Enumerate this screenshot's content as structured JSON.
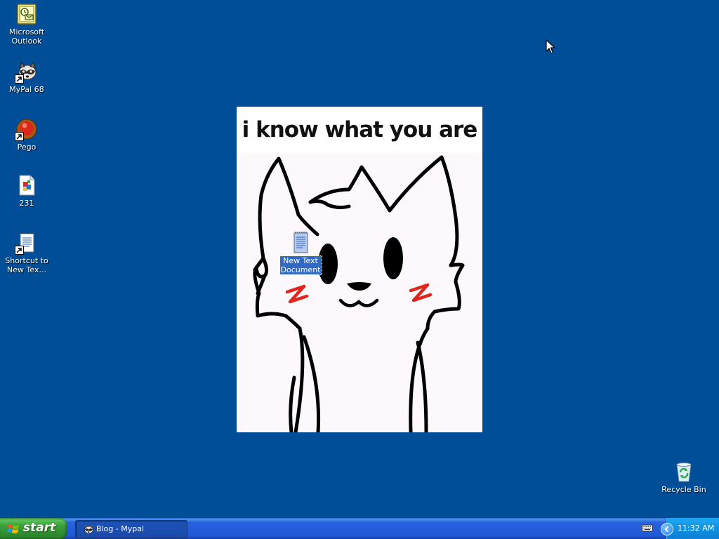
{
  "desktop": {
    "background_color": "#004e98",
    "icons": [
      {
        "label": "Microsoft\nOutlook",
        "icon": "outlook-icon"
      },
      {
        "label": "MyPal 68",
        "icon": "raccoon-browser-icon"
      },
      {
        "label": "Pego",
        "icon": "pego-icon"
      },
      {
        "label": "231",
        "icon": "image-file-icon"
      },
      {
        "label": "Shortcut to\nNew Tex...",
        "icon": "notepad-shortcut-icon"
      },
      {
        "label": "New Text\nDocument",
        "icon": "text-document-icon"
      },
      {
        "label": "Recycle Bin",
        "icon": "recycle-bin-icon"
      }
    ]
  },
  "wallpaper_image": {
    "caption": "i know what you are",
    "depiction": "white-cartoon-cat"
  },
  "taskbar": {
    "start_label": "start",
    "tasks": [
      {
        "label": "Blog - Mypal",
        "icon": "raccoon-browser-icon"
      }
    ],
    "tray": {
      "time": "11:32 AM",
      "icons": [
        "keyboard-icon",
        "show-hidden-icons-arrow"
      ]
    },
    "colors": {
      "taskbar_blue": "#245edb",
      "start_green": "#3aa23a",
      "tray_blue": "#0f8ee0"
    }
  }
}
